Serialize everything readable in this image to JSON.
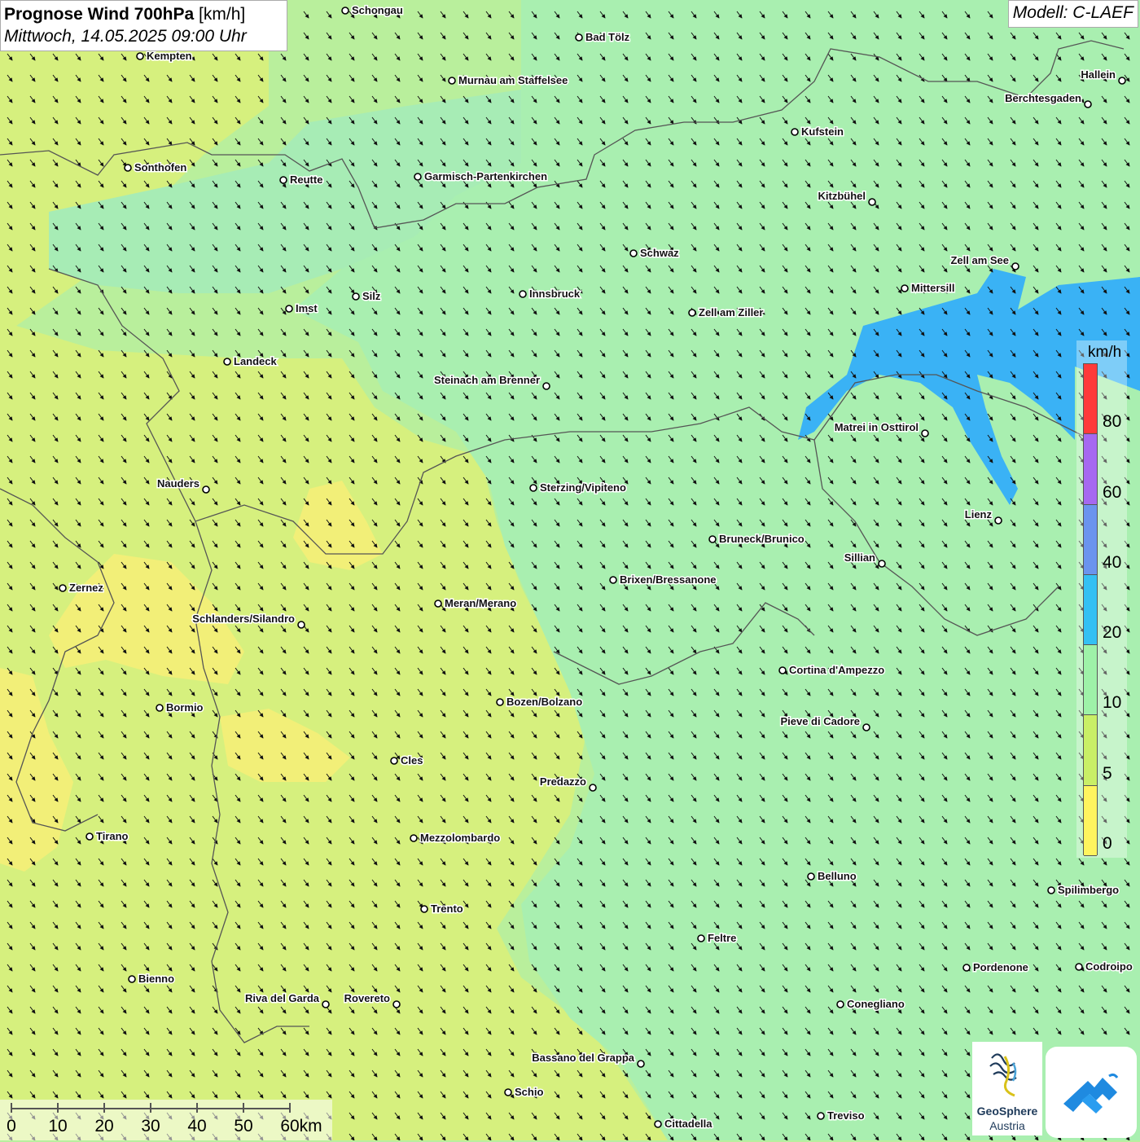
{
  "title": {
    "main": "Prognose Wind 700hPa",
    "unit": "[km/h]",
    "datetime": "Mittwoch, 14.05.2025 09:00 Uhr"
  },
  "model": "Modell: C-LAEF",
  "legend": {
    "unit": "km/h",
    "segments": [
      {
        "color": "#ff3a3a",
        "value": 80
      },
      {
        "color": "#a668f0",
        "value": 60
      },
      {
        "color": "#6b94ee",
        "value": 40
      },
      {
        "color": "#34c0f3",
        "value": 20
      },
      {
        "color": "#9ef2a8",
        "value": 10
      },
      {
        "color": "#c9ef66",
        "value": 5
      },
      {
        "color": "#fff45e",
        "value": 0
      }
    ],
    "labels": [
      "80",
      "60",
      "40",
      "20",
      "10",
      "5",
      "0"
    ]
  },
  "scale_bar": {
    "labels": [
      "0",
      "10",
      "20",
      "30",
      "40",
      "50",
      "60km"
    ]
  },
  "logo": {
    "name": "GeoSphere",
    "subtitle": "Austria"
  },
  "map": {
    "wind_direction": "north-west wind, arrows pointing south-east",
    "field_colors": {
      "yellow": "#f5f07a",
      "yellow_green": "#d8f07d",
      "light_green": "#b9ef9c",
      "green": "#a6f0b0",
      "blue": "#3ab0f3"
    },
    "cities": [
      {
        "name": "Schongau"
      },
      {
        "name": "Bad Tölz"
      },
      {
        "name": "Kempten"
      },
      {
        "name": "Murnau am Staffelsee"
      },
      {
        "name": "Hallein"
      },
      {
        "name": "Berchtesgaden"
      },
      {
        "name": "Kufstein"
      },
      {
        "name": "Sonthofen"
      },
      {
        "name": "Reutte"
      },
      {
        "name": "Garmisch-Partenkirchen"
      },
      {
        "name": "Kitzbühel"
      },
      {
        "name": "Schwaz"
      },
      {
        "name": "Zell am See"
      },
      {
        "name": "Mittersill"
      },
      {
        "name": "Silz"
      },
      {
        "name": "Imst"
      },
      {
        "name": "Innsbruck"
      },
      {
        "name": "Zell am Ziller"
      },
      {
        "name": "Landeck"
      },
      {
        "name": "Steinach am Brenner"
      },
      {
        "name": "Matrei in Osttirol"
      },
      {
        "name": "Nauders"
      },
      {
        "name": "Sterzing/Vipiteno"
      },
      {
        "name": "Lienz"
      },
      {
        "name": "Bruneck/Brunico"
      },
      {
        "name": "Sillian"
      },
      {
        "name": "Zernez"
      },
      {
        "name": "Brixen/Bressanone"
      },
      {
        "name": "Meran/Merano"
      },
      {
        "name": "Schlanders/Silandro"
      },
      {
        "name": "Cortina d'Ampezzo"
      },
      {
        "name": "Bozen/Bolzano"
      },
      {
        "name": "Bormio"
      },
      {
        "name": "Pieve di Cadore"
      },
      {
        "name": "Cles"
      },
      {
        "name": "Predazzo"
      },
      {
        "name": "Tirano"
      },
      {
        "name": "Mezzolombardo"
      },
      {
        "name": "Belluno"
      },
      {
        "name": "Spilimbergo"
      },
      {
        "name": "Trento"
      },
      {
        "name": "Feltre"
      },
      {
        "name": "Pordenone"
      },
      {
        "name": "Codroipo"
      },
      {
        "name": "Bienno"
      },
      {
        "name": "Riva del Garda"
      },
      {
        "name": "Rovereto"
      },
      {
        "name": "Conegliano"
      },
      {
        "name": "Bassano del Grappa"
      },
      {
        "name": "Schio"
      },
      {
        "name": "Treviso"
      },
      {
        "name": "Cittadella"
      }
    ]
  }
}
